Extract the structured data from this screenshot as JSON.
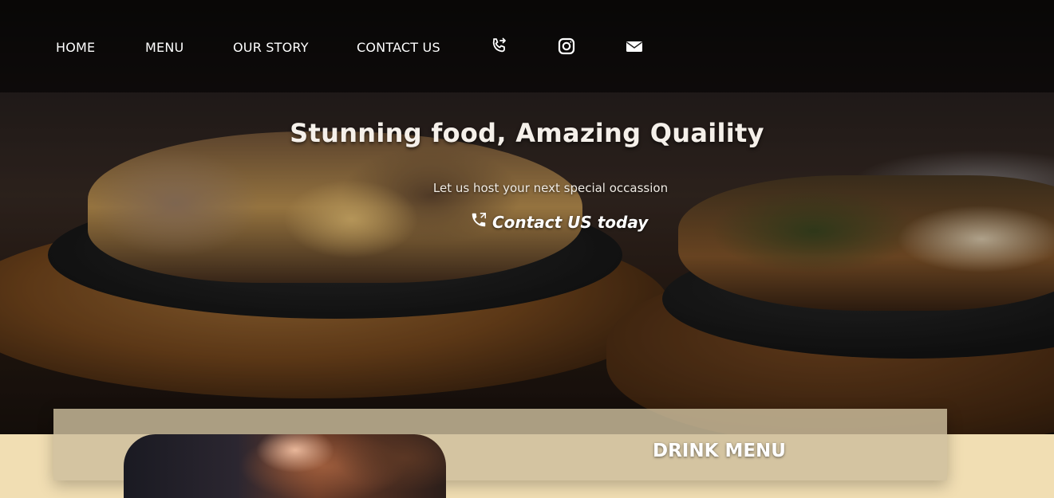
{
  "nav": {
    "items": [
      {
        "label": "HOME"
      },
      {
        "label": "MENU"
      },
      {
        "label": "OUR STORY"
      },
      {
        "label": "CONTACT US"
      }
    ],
    "icons": [
      "phone-forward-icon",
      "instagram-icon",
      "mail-icon"
    ]
  },
  "hero": {
    "headline": "Stunning food, Amazing Quaility",
    "subline": "Let us host your next special occassion",
    "cta_label": "Contact US today",
    "cta_icon": "phone-icon"
  },
  "section": {
    "title": "DRINK MENU"
  },
  "colors": {
    "text_light": "#ffffff",
    "section_bg": "#f1deb3",
    "nav_overlay": "#000000"
  }
}
